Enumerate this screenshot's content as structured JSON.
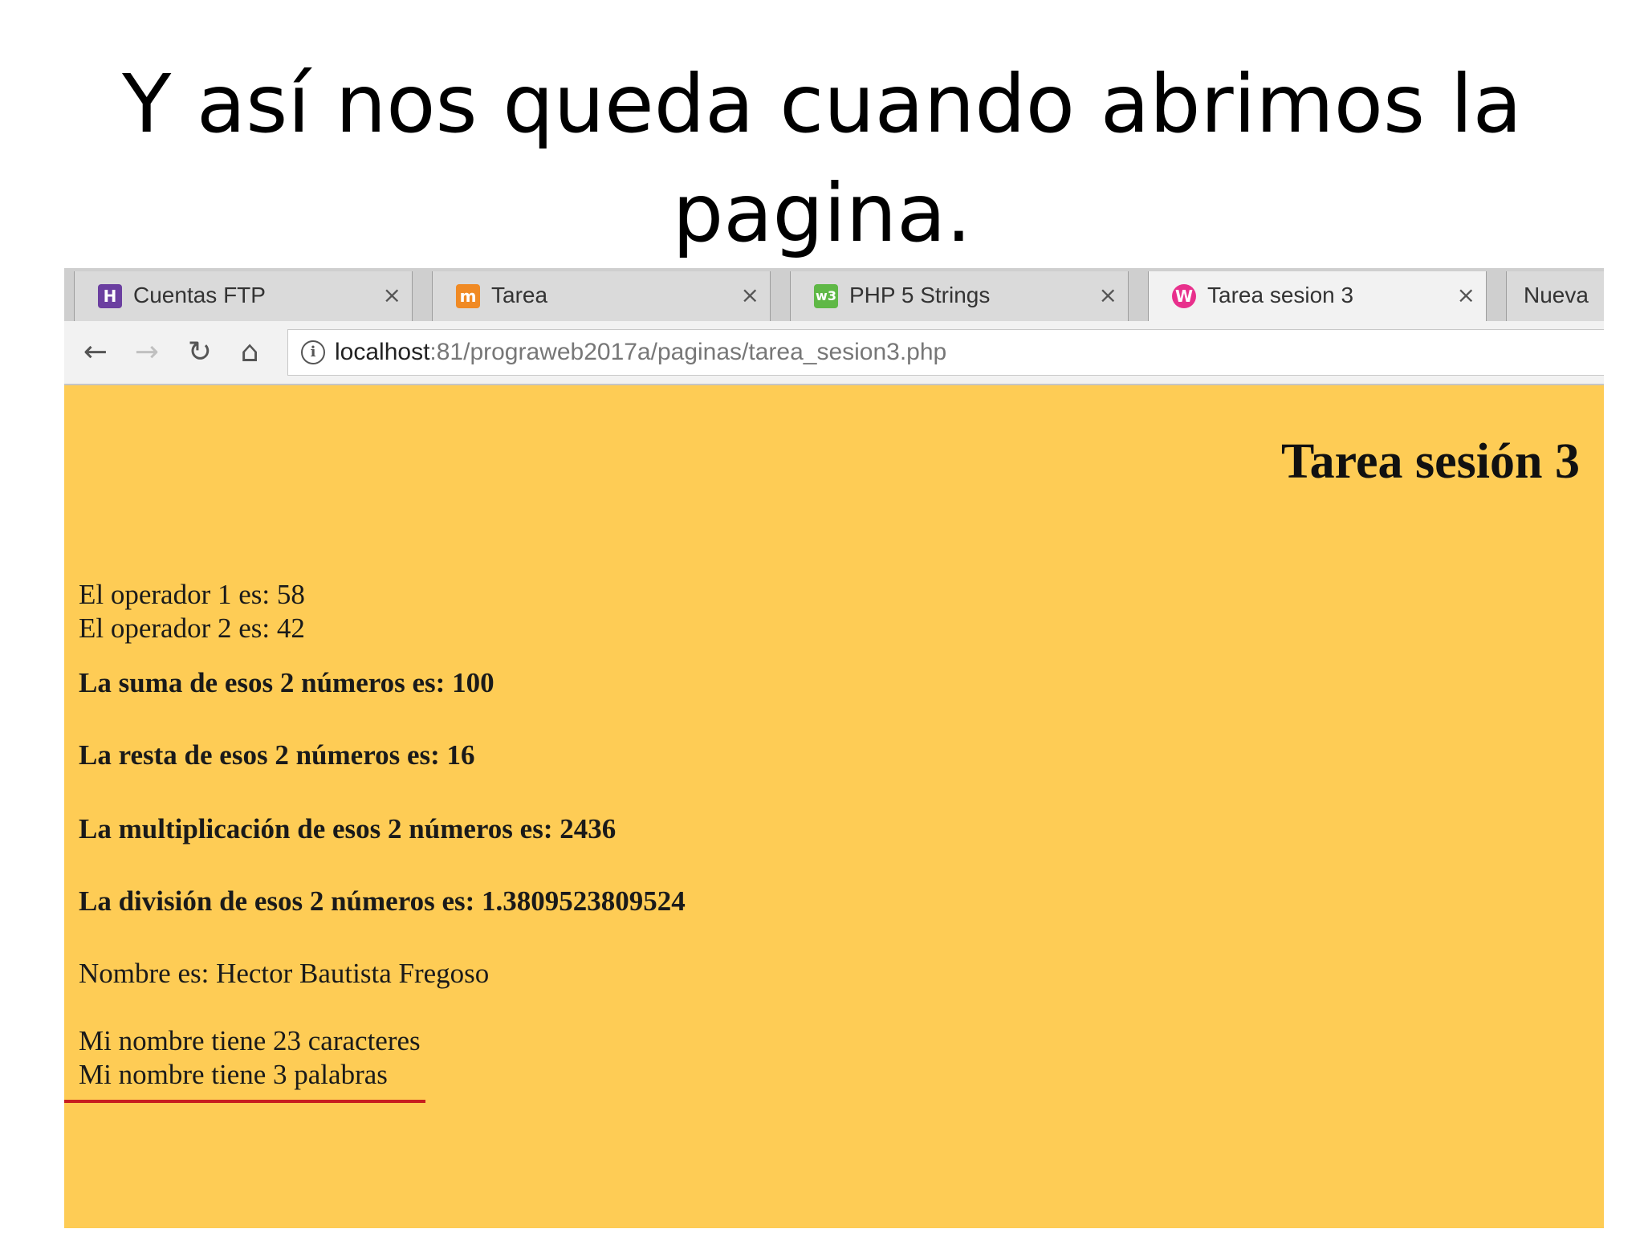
{
  "slide": {
    "title": "Y así nos queda cuando abrimos la pagina."
  },
  "browser": {
    "tabs": [
      {
        "label": "Cuentas FTP",
        "icon": "hostinger-icon",
        "icon_glyph": "H",
        "icon_color": "#6b3fa0",
        "close": "×",
        "active": false
      },
      {
        "label": "Tarea",
        "icon": "moodle-icon",
        "icon_glyph": "m",
        "icon_color": "#f08a24",
        "close": "×",
        "active": false
      },
      {
        "label": "PHP 5 Strings",
        "icon": "w3schools-icon",
        "icon_glyph": "w3",
        "icon_color": "#5fb846",
        "close": "×",
        "active": false
      },
      {
        "label": "Tarea sesion 3",
        "icon": "wampserver-icon",
        "icon_glyph": "W",
        "icon_color": "#e8308c",
        "close": "×",
        "active": true
      },
      {
        "label": "Nueva",
        "active": false
      }
    ],
    "nav": {
      "back": "←",
      "forward": "→",
      "reload": "↻",
      "home": "⌂"
    },
    "address": {
      "info": "i",
      "host": "localhost",
      "path": ":81/prograweb2017a/paginas/tarea_sesion3.php"
    }
  },
  "page": {
    "background": "#fecc55",
    "heading": "Tarea sesión 3",
    "operator1": "El operador 1 es: 58",
    "operator2": "El operador 2 es: 42",
    "sum": "La suma de esos 2 números es: 100",
    "subtraction": "La resta de esos 2 números es: 16",
    "multiplication": "La multiplicación de esos 2 números es: 2436",
    "division": "La división de esos 2 números es: 1.3809523809524",
    "name": "Nombre es: Hector Bautista Fregoso",
    "char_count": "Mi nombre tiene 23 caracteres",
    "word_count": "Mi nombre tiene 3 palabras"
  },
  "annotation": {
    "underline_color": "#c81e1e"
  }
}
